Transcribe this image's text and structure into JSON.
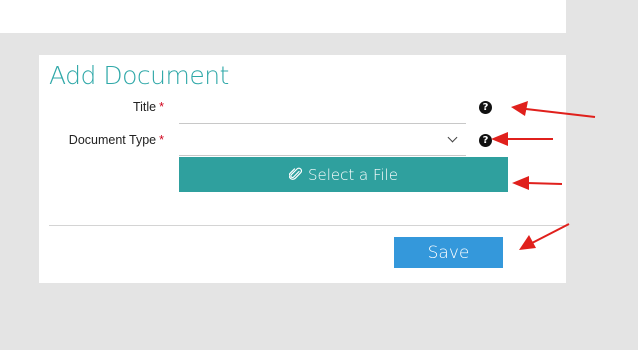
{
  "form": {
    "title": "Add Document",
    "title_field": {
      "label": "Title",
      "required_mark": "*",
      "value": ""
    },
    "document_type_field": {
      "label": "Document Type",
      "required_mark": "*",
      "selected": ""
    },
    "help_icon_glyph": "?",
    "select_file_label": "Select a File",
    "save_label": "Save"
  },
  "annotations": {
    "arrow_color": "#e0201c",
    "arrow_count": 4
  },
  "colors": {
    "accent_teal": "#2fa09e",
    "title_teal": "#2fa8a8",
    "save_blue": "#3498db"
  }
}
